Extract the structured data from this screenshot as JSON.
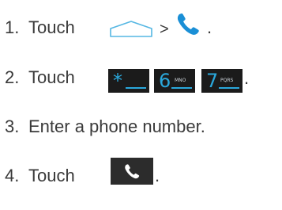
{
  "steps": [
    {
      "number": "1.",
      "text": "Touch"
    },
    {
      "number": "2.",
      "text": "Touch"
    },
    {
      "number": "3.",
      "text": "Enter a phone number."
    },
    {
      "number": "4.",
      "text": "Touch"
    }
  ],
  "separator": ">",
  "period": ".",
  "keys": [
    {
      "main": "*",
      "sub": "",
      "icon": "star-key"
    },
    {
      "main": "6",
      "sub": "MNO",
      "icon": "six-key"
    },
    {
      "main": "7",
      "sub": "PQRS",
      "icon": "seven-key"
    }
  ],
  "colors": {
    "text": "#3a3a3a",
    "phone_blue": "#1a8fd6",
    "key_bg": "#1b1b1b",
    "key_accent": "#2aa8dc",
    "call_button_bg": "#2c2c2c"
  },
  "icons": [
    "home-outline-icon",
    "phone-icon",
    "phone-call-icon"
  ]
}
